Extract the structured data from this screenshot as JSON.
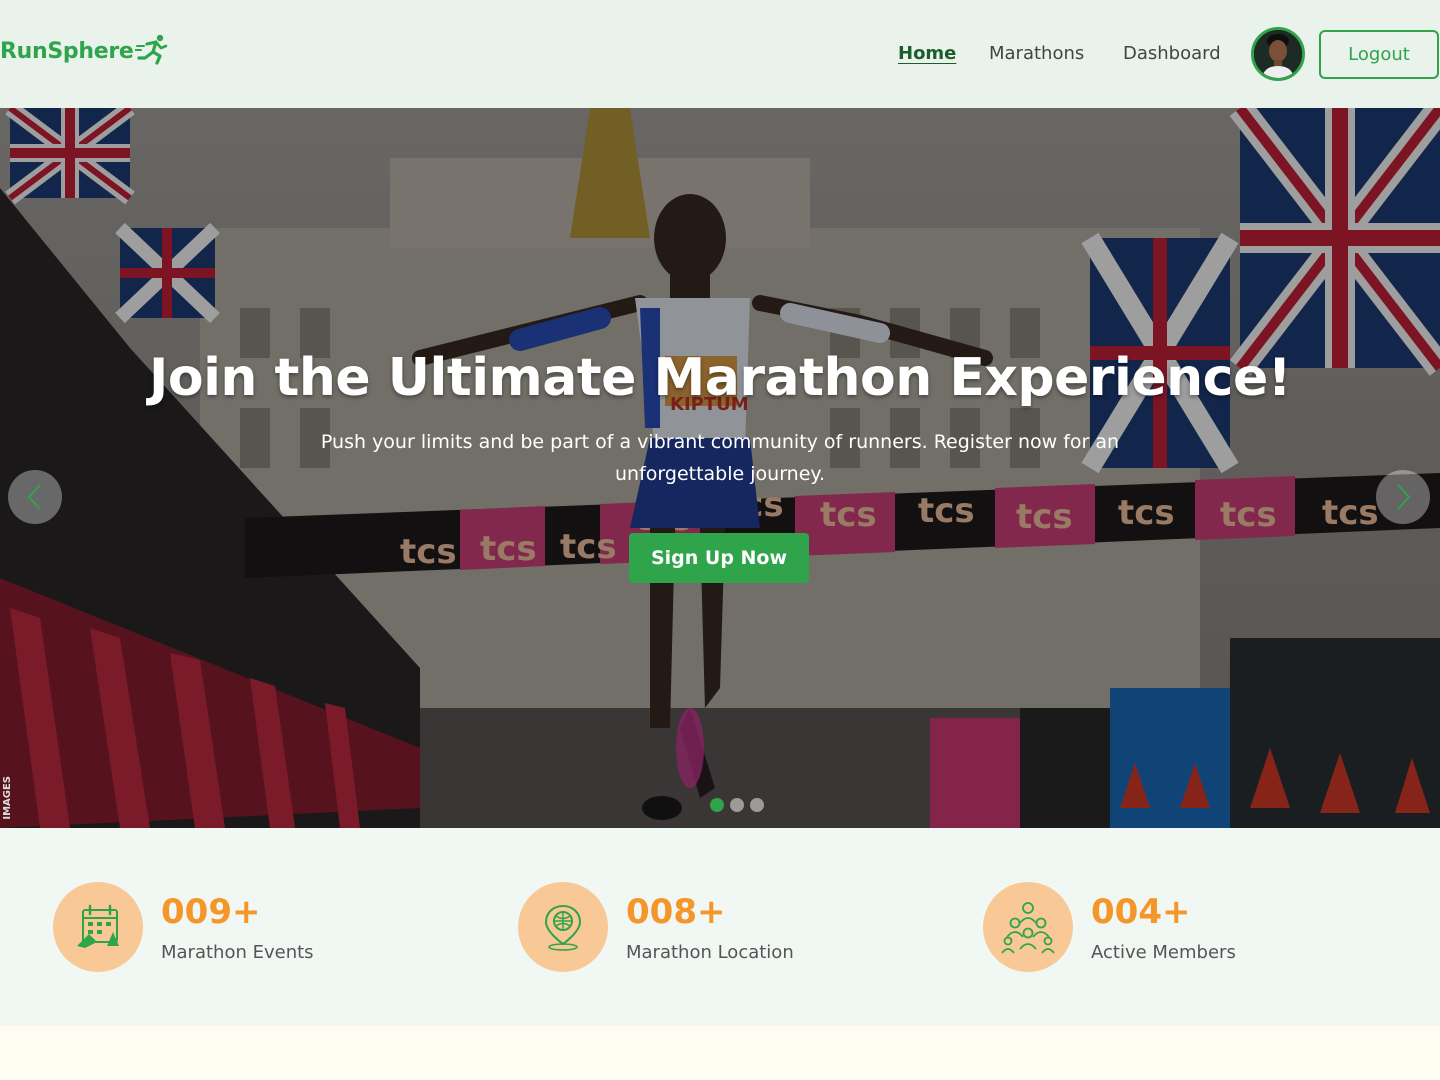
{
  "brand": {
    "name": "RunSphere",
    "icon": "runner-icon"
  },
  "nav": {
    "links": [
      {
        "label": "Home",
        "active": true
      },
      {
        "label": "Marathons",
        "active": false
      },
      {
        "label": "Dashboard",
        "active": false
      }
    ],
    "logout_label": "Logout"
  },
  "hero": {
    "title": "Join the Ultimate Marathon Experience!",
    "subtitle": "Push your limits and be part of a vibrant community of runners. Register now for an unforgettable journey.",
    "cta_label": "Sign Up Now",
    "prev_icon": "chevron-left-icon",
    "next_icon": "chevron-right-icon",
    "slide_count": 3,
    "active_slide": 1,
    "photo_watermark": "IMAGES",
    "banner_text": "tcs",
    "bib_text": "KIPTUM"
  },
  "stats": [
    {
      "value": "009+",
      "label": "Marathon Events",
      "icon": "calendar-icon"
    },
    {
      "value": "008+",
      "label": "Marathon Location",
      "icon": "location-pin-icon"
    },
    {
      "value": "004+",
      "label": "Active Members",
      "icon": "community-icon"
    }
  ],
  "colors": {
    "brand_green": "#2fa44a",
    "stat_orange": "#f5962a",
    "icon_bg": "#f8c996"
  }
}
